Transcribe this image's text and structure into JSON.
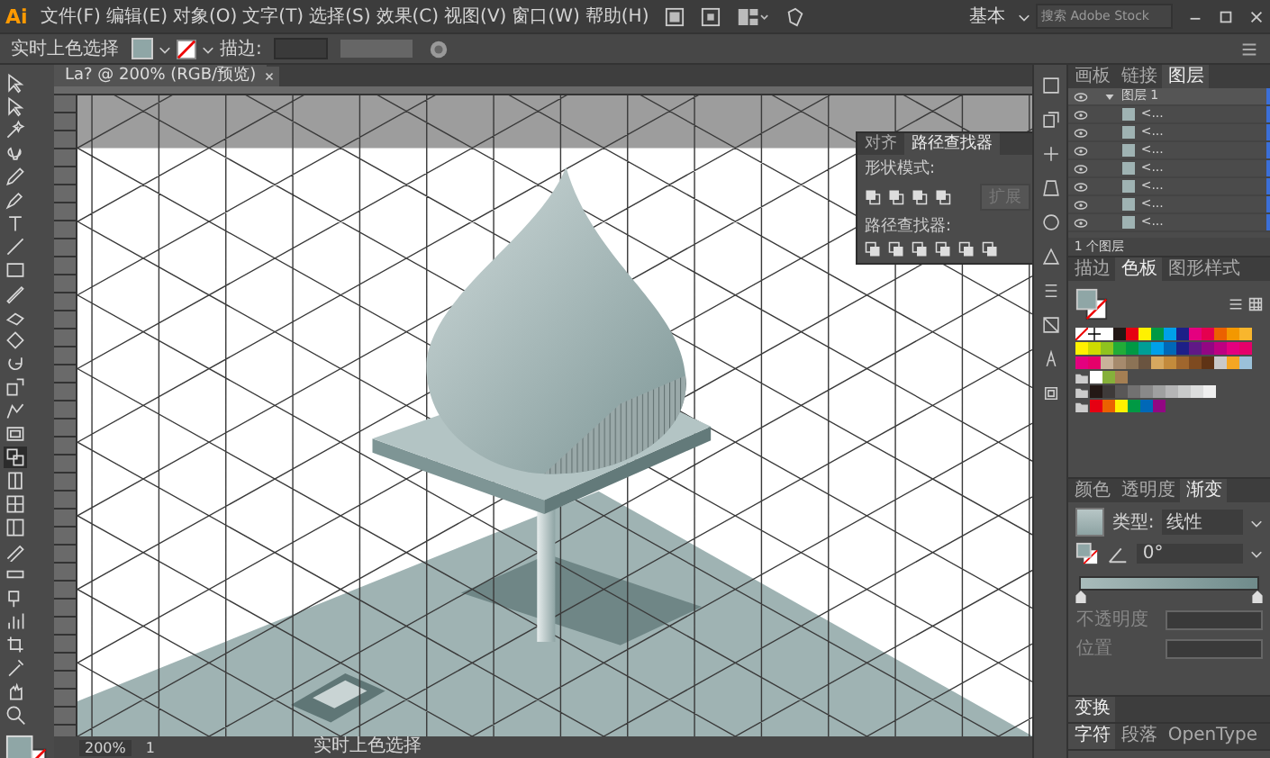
{
  "app_logo": "Ai",
  "menu": [
    "文件(F)",
    "编辑(E)",
    "对象(O)",
    "文字(T)",
    "选择(S)",
    "效果(C)",
    "视图(V)",
    "窗口(W)",
    "帮助(H)"
  ],
  "workspace": {
    "label": "基本"
  },
  "search": {
    "placeholder": "搜索 Adobe Stock"
  },
  "control_bar": {
    "selection_label": "实时上色选择",
    "stroke_label": "描边:"
  },
  "document_tab": {
    "title": "La? @ 200% (RGB/预览)"
  },
  "pathfinder_panel": {
    "tabs": [
      {
        "label": "对齐",
        "selected": false
      },
      {
        "label": "路径查找器",
        "selected": true
      }
    ],
    "shape_modes_label": "形状模式:",
    "expand_button": {
      "label": "扩展",
      "disabled": true
    },
    "pathfinders_label": "路径查找器:"
  },
  "layers_panel": {
    "tabs": [
      {
        "label": "画板",
        "selected": false
      },
      {
        "label": "链接",
        "selected": false
      },
      {
        "label": "图层",
        "selected": true
      }
    ],
    "layers": [
      {
        "name": "图层 1",
        "expanded": true,
        "children": [
          {
            "name": "<..."
          },
          {
            "name": "<..."
          },
          {
            "name": "<..."
          },
          {
            "name": "<..."
          },
          {
            "name": "<..."
          },
          {
            "name": "<..."
          },
          {
            "name": "<..."
          }
        ]
      }
    ],
    "footer": "1 个图层"
  },
  "swatches_panel": {
    "tabs": [
      {
        "label": "描边",
        "selected": false
      },
      {
        "label": "色板",
        "selected": true
      },
      {
        "label": "图形样式",
        "selected": false
      }
    ],
    "rows": [
      {
        "group": false,
        "swatches": [
          {
            "kind": "none"
          },
          {
            "kind": "registration"
          },
          {
            "kind": "color",
            "color": "#ffffff"
          },
          {
            "kind": "color",
            "color": "#231815"
          },
          {
            "kind": "color",
            "color": "#e60012"
          },
          {
            "kind": "color",
            "color": "#fff100"
          },
          {
            "kind": "color",
            "color": "#009944"
          },
          {
            "kind": "color",
            "color": "#00a0e9"
          },
          {
            "kind": "color",
            "color": "#1d2088"
          },
          {
            "kind": "color",
            "color": "#e4007f"
          },
          {
            "kind": "color",
            "color": "#e5004f"
          },
          {
            "kind": "color",
            "color": "#eb6100"
          },
          {
            "kind": "color",
            "color": "#f39800"
          },
          {
            "kind": "color",
            "color": "#f8b62d"
          }
        ]
      },
      {
        "group": false,
        "swatches": [
          {
            "kind": "color",
            "color": "#fff100"
          },
          {
            "kind": "color",
            "color": "#cfdb00"
          },
          {
            "kind": "color",
            "color": "#8fc31f"
          },
          {
            "kind": "color",
            "color": "#22ac38"
          },
          {
            "kind": "color",
            "color": "#009944"
          },
          {
            "kind": "color",
            "color": "#009e96"
          },
          {
            "kind": "color",
            "color": "#00a0e9"
          },
          {
            "kind": "color",
            "color": "#0068b7"
          },
          {
            "kind": "color",
            "color": "#1d2088"
          },
          {
            "kind": "color",
            "color": "#601986"
          },
          {
            "kind": "color",
            "color": "#920783"
          },
          {
            "kind": "color",
            "color": "#be0081"
          },
          {
            "kind": "color",
            "color": "#e4007f"
          },
          {
            "kind": "color",
            "color": "#e5006a"
          }
        ]
      },
      {
        "group": false,
        "swatches": [
          {
            "kind": "color",
            "color": "#e4007f"
          },
          {
            "kind": "color",
            "color": "#e5006a"
          },
          {
            "kind": "color",
            "color": "#c9b29a"
          },
          {
            "kind": "color",
            "color": "#a68a6d"
          },
          {
            "kind": "color",
            "color": "#8c7356"
          },
          {
            "kind": "color",
            "color": "#6a5440"
          },
          {
            "kind": "color",
            "color": "#d6a85f"
          },
          {
            "kind": "color",
            "color": "#c38b3c"
          },
          {
            "kind": "color",
            "color": "#a0662d"
          },
          {
            "kind": "color",
            "color": "#7e4a20"
          },
          {
            "kind": "color",
            "color": "#5f3315"
          },
          {
            "kind": "color",
            "color": "#c9c9c9"
          },
          {
            "kind": "color",
            "color": "#f5a623"
          },
          {
            "kind": "color",
            "color": "#9bc1d9"
          }
        ]
      },
      {
        "group": true,
        "swatches": [
          {
            "kind": "color",
            "color": "#ffffff"
          },
          {
            "kind": "color",
            "color": "#86b03a"
          },
          {
            "kind": "color",
            "color": "#a57f53"
          }
        ]
      },
      {
        "group": true,
        "swatches": [
          {
            "kind": "color",
            "color": "#231815"
          },
          {
            "kind": "color",
            "color": "#3e3a39"
          },
          {
            "kind": "color",
            "color": "#595757"
          },
          {
            "kind": "color",
            "color": "#727171"
          },
          {
            "kind": "color",
            "color": "#898989"
          },
          {
            "kind": "color",
            "color": "#9fa0a0"
          },
          {
            "kind": "color",
            "color": "#b5b5b6"
          },
          {
            "kind": "color",
            "color": "#c9caca"
          },
          {
            "kind": "color",
            "color": "#dcdddd"
          },
          {
            "kind": "color",
            "color": "#efefef"
          }
        ]
      },
      {
        "group": true,
        "swatches": [
          {
            "kind": "color",
            "color": "#e60012"
          },
          {
            "kind": "color",
            "color": "#eb6100"
          },
          {
            "kind": "color",
            "color": "#fff100"
          },
          {
            "kind": "color",
            "color": "#009944"
          },
          {
            "kind": "color",
            "color": "#0068b7"
          },
          {
            "kind": "color",
            "color": "#920783"
          }
        ]
      }
    ]
  },
  "gradient_panel": {
    "tabs": [
      {
        "label": "颜色",
        "selected": false
      },
      {
        "label": "透明度",
        "selected": false
      },
      {
        "label": "渐变",
        "selected": true
      }
    ],
    "type_label": "类型:",
    "type_value": "线性",
    "angle": "0°",
    "opacity_label": "不透明度",
    "location_label": "位置"
  },
  "transform_panel": {
    "label": "变换"
  },
  "character_panel": {
    "tabs": [
      {
        "label": "字符",
        "selected": true
      },
      {
        "label": "段落",
        "selected": false
      },
      {
        "label": "OpenType",
        "selected": false
      }
    ]
  },
  "status_bar": {
    "zoom": "200%",
    "artboard": "1",
    "tool": "实时上色选择"
  }
}
